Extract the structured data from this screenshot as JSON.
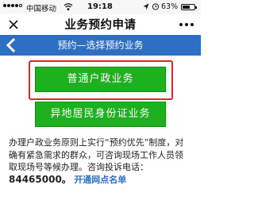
{
  "status_bar": {
    "carrier": "中国移动",
    "time": "19:18",
    "battery_percent_label": "63%",
    "battery_level": 0.63,
    "signal_bars_filled": 4,
    "signal_bars_total": 5,
    "icons": [
      "signal-dots-icon",
      "wifi-icon",
      "location-arrow-icon",
      "alarm-icon",
      "battery-icon"
    ]
  },
  "nav": {
    "close_icon": "close-icon",
    "title": "业务预约申请",
    "more_icon": "more-dots-icon"
  },
  "page_header": {
    "back_icon": "chevron-left-icon",
    "title": "预约—选择预约业务"
  },
  "options": [
    {
      "label": "普通户政业务",
      "highlighted": true
    },
    {
      "label": "异地居民身份证业务",
      "highlighted": false
    }
  ],
  "notice": {
    "line1": "办理户政业务原则上实行“预约优先”制度，对",
    "line2": "确有紧急需求的群众，可咨询现场工作人员领",
    "line3": "取现场号等候办理。咨询投诉电话：",
    "phone": "84465000。",
    "link": "开通网点名单"
  },
  "colors": {
    "header_blue": "#2f6fc3",
    "button_green": "#1eb01e",
    "highlight_red": "#e0282b"
  }
}
